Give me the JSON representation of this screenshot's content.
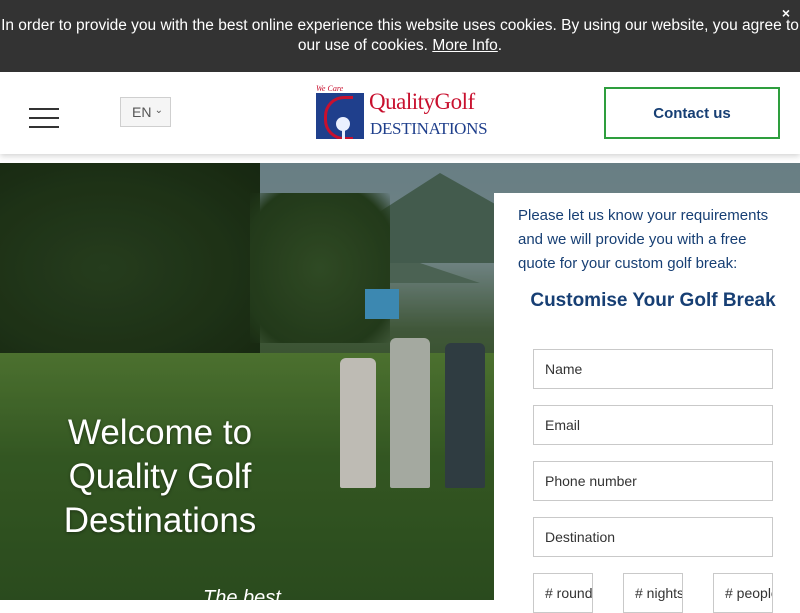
{
  "cookie_bar": {
    "text": "In order to provide you with the best online experience this website uses cookies. By using our website, you agree to our use of cookies.",
    "link_label": "More Info",
    "link_suffix": ".",
    "close_label": "×"
  },
  "header": {
    "language": "EN",
    "logo": {
      "tagline": "We Care",
      "name_line1": "QualityGolf",
      "name_line2": "DESTINATIONS"
    },
    "contact_label": "Contact us"
  },
  "hero": {
    "title": "Welcome to Quality Golf Destinations",
    "subtitle": "The best"
  },
  "form": {
    "intro": "Please let us know your requirements and we will provide you with a free quote for your custom golf break:",
    "heading": "Customise Your Golf Break",
    "fields": {
      "name": "Name",
      "email": "Email",
      "phone": "Phone number",
      "destination": "Destination",
      "rounds": "# rounds",
      "nights": "# nights",
      "people": "# people"
    }
  },
  "colors": {
    "cookie_bg": "#333333",
    "brand_navy": "#173f74",
    "brand_red": "#c8102e",
    "accent_green": "#2e9e3e"
  }
}
